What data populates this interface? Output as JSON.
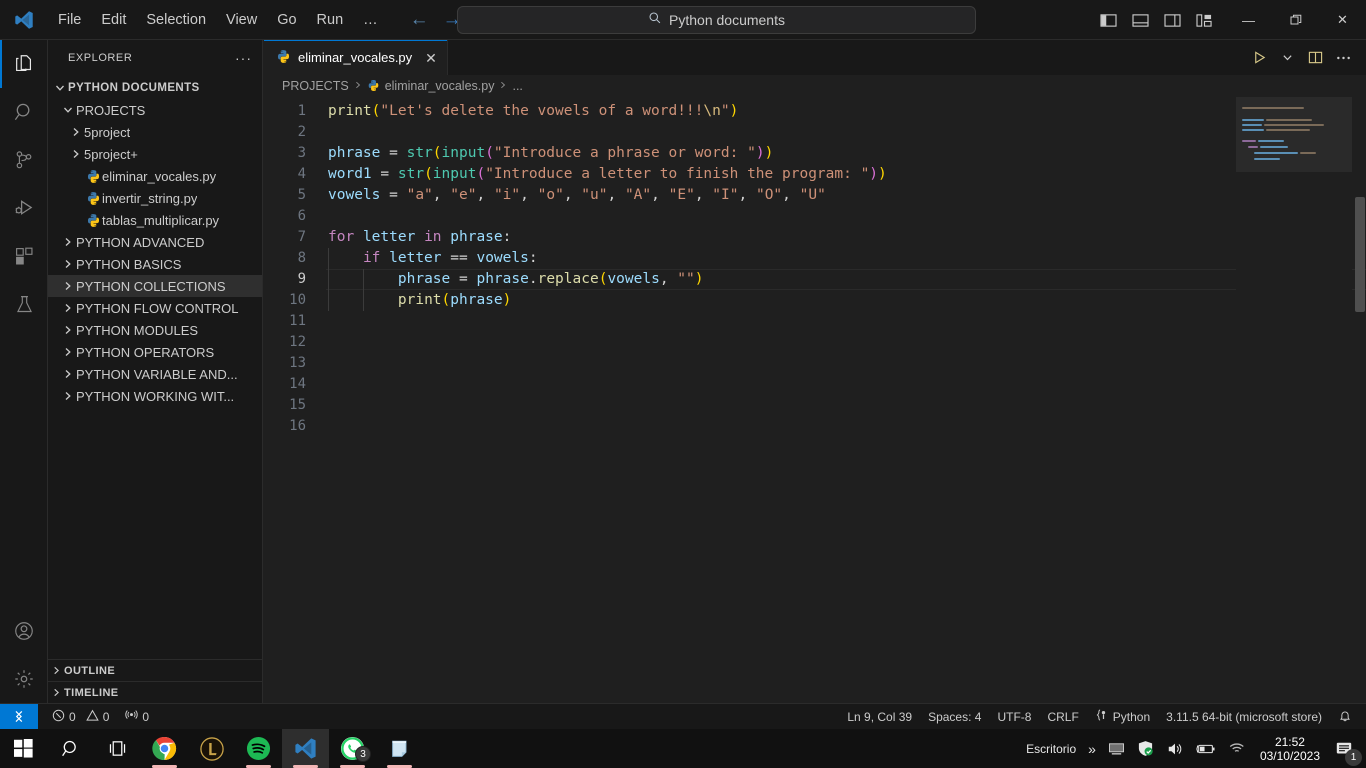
{
  "titlebar": {
    "logo": "vscode-logo",
    "menu": [
      "File",
      "Edit",
      "Selection",
      "View",
      "Go",
      "Run",
      "…"
    ],
    "back_arrow": "←",
    "forward_arrow": "→",
    "search_placeholder": "Python documents",
    "search_icon": "search-icon",
    "layout_icons": [
      "toggle-primary-sidebar-icon",
      "toggle-panel-icon",
      "toggle-secondary-sidebar-icon",
      "customize-layout-icon"
    ],
    "window_minimize": "—",
    "window_maximize": "❐",
    "window_close": "✕"
  },
  "activitybar": {
    "items": [
      {
        "name": "explorer",
        "icon": "files-icon",
        "active": true
      },
      {
        "name": "search",
        "icon": "search-icon",
        "active": false
      },
      {
        "name": "source-control",
        "icon": "source-control-icon",
        "active": false
      },
      {
        "name": "run-and-debug",
        "icon": "run-debug-icon",
        "active": false
      },
      {
        "name": "extensions",
        "icon": "extensions-icon",
        "active": false
      },
      {
        "name": "testing",
        "icon": "beaker-icon",
        "active": false
      }
    ],
    "bottom": [
      {
        "name": "accounts",
        "icon": "account-icon"
      },
      {
        "name": "manage-settings",
        "icon": "gear-icon"
      }
    ]
  },
  "sidebar": {
    "title": "EXPLORER",
    "more_actions": "···",
    "tree": [
      {
        "label": "PYTHON DOCUMENTS",
        "depth": 0,
        "type": "root",
        "expanded": true,
        "selected": false
      },
      {
        "label": "PROJECTS",
        "depth": 1,
        "type": "folder",
        "expanded": true,
        "selected": false
      },
      {
        "label": "5project",
        "depth": 2,
        "type": "folder",
        "expanded": false,
        "selected": false
      },
      {
        "label": "5project+",
        "depth": 2,
        "type": "folder",
        "expanded": false,
        "selected": false
      },
      {
        "label": "eliminar_vocales.py",
        "depth": 2,
        "type": "python-file",
        "expanded": false,
        "selected": false
      },
      {
        "label": "invertir_string.py",
        "depth": 2,
        "type": "python-file",
        "expanded": false,
        "selected": false
      },
      {
        "label": "tablas_multiplicar.py",
        "depth": 2,
        "type": "python-file",
        "expanded": false,
        "selected": false
      },
      {
        "label": "PYTHON ADVANCED",
        "depth": 1,
        "type": "folder",
        "expanded": false,
        "selected": false
      },
      {
        "label": "PYTHON BASICS",
        "depth": 1,
        "type": "folder",
        "expanded": false,
        "selected": false
      },
      {
        "label": "PYTHON COLLECTIONS",
        "depth": 1,
        "type": "folder",
        "expanded": false,
        "selected": true
      },
      {
        "label": "PYTHON FLOW CONTROL",
        "depth": 1,
        "type": "folder",
        "expanded": false,
        "selected": false
      },
      {
        "label": "PYTHON MODULES",
        "depth": 1,
        "type": "folder",
        "expanded": false,
        "selected": false
      },
      {
        "label": "PYTHON OPERATORS",
        "depth": 1,
        "type": "folder",
        "expanded": false,
        "selected": false
      },
      {
        "label": "PYTHON VARIABLE AND...",
        "depth": 1,
        "type": "folder",
        "expanded": false,
        "selected": false
      },
      {
        "label": "PYTHON WORKING WIT...",
        "depth": 1,
        "type": "folder",
        "expanded": false,
        "selected": false
      }
    ],
    "sections": [
      {
        "label": "OUTLINE",
        "expanded": false
      },
      {
        "label": "TIMELINE",
        "expanded": false
      }
    ]
  },
  "editor": {
    "tabs": [
      {
        "label": "eliminar_vocales.py",
        "icon": "python-file-icon",
        "active": true,
        "close": "✕"
      }
    ],
    "actions": [
      {
        "name": "run-python-file",
        "icon": "play-icon"
      },
      {
        "name": "run-options-dropdown",
        "icon": "chevron-down-icon"
      },
      {
        "name": "split-editor-right",
        "icon": "split-editor-icon"
      },
      {
        "name": "more-actions",
        "icon": "ellipsis-icon"
      }
    ],
    "breadcrumb": [
      {
        "label": "PROJECTS",
        "icon": null
      },
      {
        "label": "eliminar_vocales.py",
        "icon": "python-file-icon"
      },
      {
        "label": "...",
        "icon": null
      }
    ],
    "line_numbers": [
      "1",
      "2",
      "3",
      "4",
      "5",
      "6",
      "7",
      "8",
      "9",
      "10",
      "11",
      "12",
      "13",
      "14",
      "15",
      "16"
    ],
    "active_line": 9,
    "code_lines": [
      "print(\"Let's delete the vowels of a word!!!\\n\")",
      "",
      "phrase = str(input(\"Introduce a phrase or word: \"))",
      "word1 = str(input(\"Introduce a letter to finish the program: \"))",
      "vowels = \"a\", \"e\", \"i\", \"o\", \"u\", \"A\", \"E\", \"I\", \"O\", \"U\"",
      "",
      "for letter in phrase:",
      "    if letter == vowels:",
      "        phrase = phrase.replace(vowels, \"\")",
      "        print(phrase)",
      "",
      "",
      "",
      "",
      "",
      ""
    ]
  },
  "statusbar": {
    "remote_icon": "remote-window-icon",
    "problems": {
      "errors_icon": "error-icon",
      "errors": "0",
      "warnings_icon": "warning-icon",
      "warnings": "0"
    },
    "ports": {
      "icon": "radio-tower-icon",
      "count": "0"
    },
    "cursor_position": "Ln 9, Col 39",
    "indentation": "Spaces: 4",
    "encoding": "UTF-8",
    "eol": "CRLF",
    "language": "Python",
    "language_icon": "python-bracket-icon",
    "interpreter": "3.11.5 64-bit (microsoft store)",
    "bell_icon": "bell-icon"
  },
  "taskbar": {
    "icons": [
      {
        "name": "start-button",
        "icon": "windows-logo-icon",
        "running": false,
        "active": false
      },
      {
        "name": "search-taskbar",
        "icon": "search-icon",
        "running": false,
        "active": false
      },
      {
        "name": "task-view",
        "icon": "task-view-icon",
        "running": false,
        "active": false
      },
      {
        "name": "google-chrome",
        "icon": "chrome-icon",
        "running": true,
        "active": false
      },
      {
        "name": "league-of-legends",
        "icon": "lol-icon",
        "running": false,
        "active": false
      },
      {
        "name": "spotify",
        "icon": "spotify-icon",
        "running": true,
        "active": false
      },
      {
        "name": "visual-studio-code",
        "icon": "vscode-icon",
        "running": true,
        "active": true
      },
      {
        "name": "whatsapp",
        "icon": "whatsapp-icon",
        "running": true,
        "active": false,
        "badge": "3"
      },
      {
        "name": "sticky-notes",
        "icon": "sticky-notes-icon",
        "running": true,
        "active": false
      }
    ],
    "desktop_label": "Escritorio",
    "overflow": "»",
    "tray": [
      {
        "name": "display-tray-icon",
        "icon": "monitor-icon"
      },
      {
        "name": "windows-security-tray-icon",
        "icon": "shield-icon"
      },
      {
        "name": "volume-tray-icon",
        "icon": "speaker-icon"
      },
      {
        "name": "battery-tray-icon",
        "icon": "battery-icon"
      },
      {
        "name": "network-tray-icon",
        "icon": "wifi-icon"
      }
    ],
    "time": "21:52",
    "date": "03/10/2023",
    "notifications_icon": "notification-icon",
    "notifications_count": "1"
  },
  "colors": {
    "accent": "#0078d4",
    "editor_bg": "#1f1f1f",
    "chrome_bg": "#181818",
    "text": "#cccccc"
  }
}
